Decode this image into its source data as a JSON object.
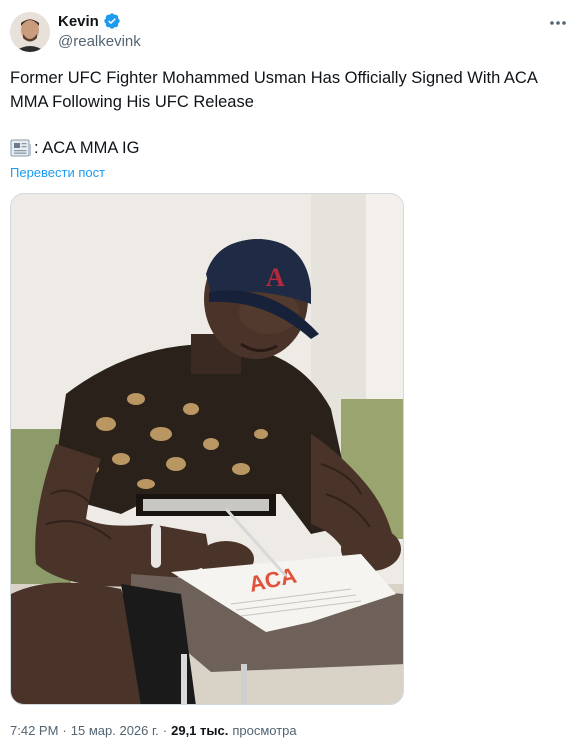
{
  "author": {
    "name": "Kevin",
    "handle": "@realkevink",
    "verified_color": "#1d9bf0"
  },
  "tweet": {
    "text": "Former UFC Fighter Mohammed Usman Has Officially Signed With ACA MMA Following His UFC Release",
    "source_icon": "newspaper-icon",
    "source_text": ": ACA MMA IG",
    "translate_label": "Перевести пост"
  },
  "meta": {
    "time": "7:42 PM",
    "separator": "·",
    "date": "15 мар. 2026 г.",
    "views_count": "29,1 тыс.",
    "views_label": "просмотра"
  },
  "colors": {
    "link": "#1d9bf0",
    "secondary_text": "#536471",
    "primary_text": "#0f1419"
  }
}
